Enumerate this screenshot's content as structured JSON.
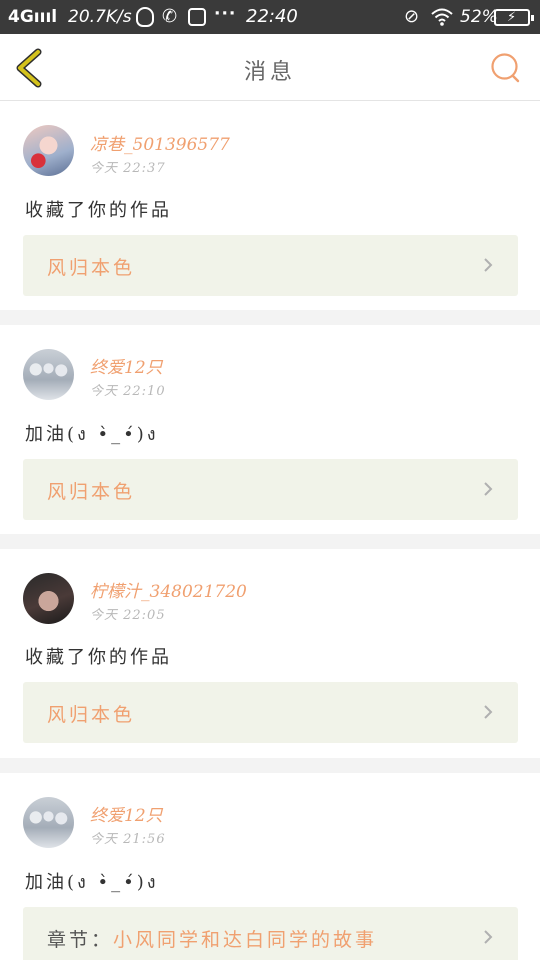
{
  "status_bar": {
    "network": "4G",
    "signal": "ıııl",
    "speed": "20.7K/s",
    "time": "22:40",
    "battery": "52%",
    "icons": [
      "qq-icon",
      "phone-icon",
      "screenshot-icon",
      "more-dots-icon",
      "mute-icon",
      "wifi-icon",
      "battery-charging-icon"
    ]
  },
  "header": {
    "title": "消息",
    "back_icon": "chevron-left-icon",
    "search_icon": "search-icon",
    "accent_color": "#f0a070",
    "back_color": "#d4c21c"
  },
  "messages": [
    {
      "username": "凉巷_501396577",
      "time": "今天 22:37",
      "content": "收藏了你的作品",
      "work": {
        "prefix": "",
        "title": "风归本色"
      }
    },
    {
      "username": "终爱12只",
      "time": "今天 22:10",
      "content": "加油(ง •̀_•́)ง",
      "work": {
        "prefix": "",
        "title": "风归本色"
      }
    },
    {
      "username": "柠檬汁_348021720",
      "time": "今天 22:05",
      "content": "收藏了你的作品",
      "work": {
        "prefix": "",
        "title": "风归本色"
      }
    },
    {
      "username": "终爱12只",
      "time": "今天 21:56",
      "content": "加油(ง •̀_•́)ง",
      "work": {
        "prefix": "章节：",
        "title": "小风同学和达白同学的故事"
      }
    }
  ]
}
